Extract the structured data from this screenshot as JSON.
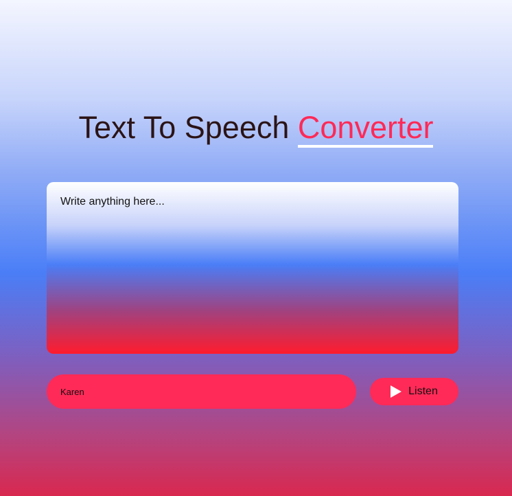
{
  "header": {
    "title_main": "Text To Speech",
    "title_accent": "Converter"
  },
  "editor": {
    "placeholder": "Write anything here..."
  },
  "voice_select": {
    "selected": "Karen"
  },
  "listen_button": {
    "label": "Listen",
    "icon": "play-icon"
  },
  "colors": {
    "accent": "#ff2a57",
    "title_text": "#2b1416",
    "underline": "#ffffff"
  }
}
